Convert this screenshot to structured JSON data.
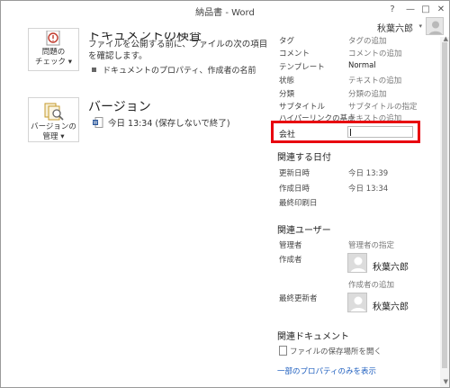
{
  "window": {
    "title": "納品書 - Word",
    "help_label": "?",
    "minimize_label": "—",
    "maximize_label": "□",
    "close_label": "✕"
  },
  "user": {
    "name": "秋葉六郎",
    "caret": "▾"
  },
  "inspect": {
    "button_line1": "問題の",
    "button_line2": "チェック ▾",
    "heading_partial": "ドキュメントの検査",
    "description_line1": "ファイルを公開する前に、ファイルの次の項目",
    "description_line2": "を確認します。",
    "bullet": "ドキュメントのプロパティ、作成者の名前"
  },
  "versions": {
    "button_line1": "バージョンの",
    "button_line2": "管理 ▾",
    "heading": "バージョン",
    "entry": "今日 13:34 (保存しないで終了)"
  },
  "properties": {
    "rows": [
      {
        "label": "タグ",
        "value": "タグの追加"
      },
      {
        "label": "コメント",
        "value": "コメントの追加"
      },
      {
        "label": "テンプレート",
        "value": "Normal"
      },
      {
        "label": "状態",
        "value": "テキストの追加"
      },
      {
        "label": "分類",
        "value": "分類の追加"
      },
      {
        "label": "サブタイトル",
        "value": "サブタイトルの指定"
      },
      {
        "label": "ハイパーリンクの基点",
        "value": "テキストの追加"
      }
    ],
    "company_label": "会社",
    "company_value": ""
  },
  "related_dates": {
    "heading": "関連する日付",
    "rows": [
      {
        "label": "更新日時",
        "value": "今日 13:39"
      },
      {
        "label": "作成日時",
        "value": "今日 13:34"
      },
      {
        "label": "最終印刷日",
        "value": ""
      }
    ]
  },
  "related_people": {
    "heading": "関連ユーザー",
    "manager_label": "管理者",
    "manager_value": "管理者の指定",
    "author_label": "作成者",
    "author_name": "秋葉六郎",
    "add_author": "作成者の追加",
    "last_modified_label": "最終更新者",
    "last_modified_name": "秋葉六郎"
  },
  "related_documents": {
    "heading": "関連ドキュメント",
    "open_location": "ファイルの保存場所を開く",
    "show_fewer": "一部のプロパティのみを表示"
  },
  "colors": {
    "highlight": "#e8000f",
    "link": "#1f5fbf"
  }
}
